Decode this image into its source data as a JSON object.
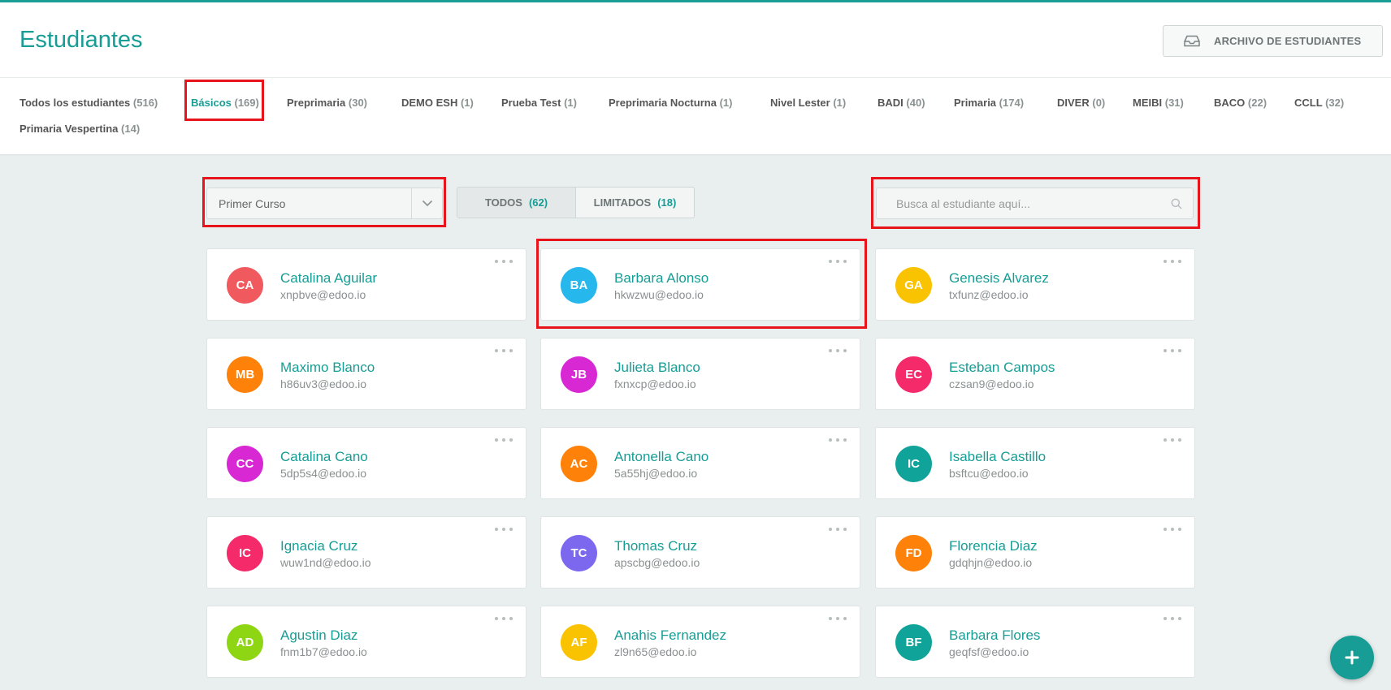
{
  "header": {
    "title": "Estudiantes",
    "archive_button": {
      "label": "ARCHIVO DE ESTUDIANTES",
      "icon": "inbox-icon"
    }
  },
  "levels": [
    {
      "name": "Todos los estudiantes",
      "count": "(516)"
    },
    {
      "name": "Básicos",
      "count": "(169)",
      "active": true
    },
    {
      "name": "Preprimaria",
      "count": "(30)"
    },
    {
      "name": "DEMO ESH",
      "count": "(1)"
    },
    {
      "name": "Prueba Test",
      "count": "(1)"
    },
    {
      "name": "Preprimaria Nocturna",
      "count": "(1)"
    },
    {
      "name": "Nivel Lester",
      "count": "(1)"
    },
    {
      "name": "BADI",
      "count": "(40)"
    },
    {
      "name": "Primaria",
      "count": "(174)"
    },
    {
      "name": "DIVER",
      "count": "(0)"
    },
    {
      "name": "MEIBI",
      "count": "(31)"
    },
    {
      "name": "BACO",
      "count": "(22)"
    },
    {
      "name": "CCLL",
      "count": "(32)"
    },
    {
      "name": "Primaria Vespertina",
      "count": "(14)"
    }
  ],
  "filters": {
    "course_select": {
      "value": "Primer Curso",
      "icon": "chevron-down-icon"
    },
    "segment": [
      {
        "label": "TODOS",
        "count": "(62)",
        "active": true
      },
      {
        "label": "LIMITADOS",
        "count": "(18)"
      }
    ],
    "search": {
      "placeholder": "Busca al estudiante aquí...",
      "value": "",
      "icon": "search-icon"
    }
  },
  "students": [
    {
      "initials": "CA",
      "name": "Catalina Aguilar",
      "email": "xnpbve@edoo.io",
      "color": "#f0595e"
    },
    {
      "initials": "BA",
      "name": "Barbara Alonso",
      "email": "hkwzwu@edoo.io",
      "color": "#26b7ec"
    },
    {
      "initials": "GA",
      "name": "Genesis Alvarez",
      "email": "txfunz@edoo.io",
      "color": "#f9c301"
    },
    {
      "initials": "MB",
      "name": "Maximo Blanco",
      "email": "h86uv3@edoo.io",
      "color": "#fe8109"
    },
    {
      "initials": "JB",
      "name": "Julieta Blanco",
      "email": "fxnxcp@edoo.io",
      "color": "#d728d4"
    },
    {
      "initials": "EC",
      "name": "Esteban Campos",
      "email": "czsan9@edoo.io",
      "color": "#f42a6a"
    },
    {
      "initials": "CC",
      "name": "Catalina Cano",
      "email": "5dp5s4@edoo.io",
      "color": "#d728d4"
    },
    {
      "initials": "AC",
      "name": "Antonella Cano",
      "email": "5a55hj@edoo.io",
      "color": "#fe8109"
    },
    {
      "initials": "IC",
      "name": "Isabella Castillo",
      "email": "bsftcu@edoo.io",
      "color": "#0fa39a"
    },
    {
      "initials": "IC",
      "name": "Ignacia Cruz",
      "email": "wuw1nd@edoo.io",
      "color": "#f42a6a"
    },
    {
      "initials": "TC",
      "name": "Thomas Cruz",
      "email": "apscbg@edoo.io",
      "color": "#7b68ee"
    },
    {
      "initials": "FD",
      "name": "Florencia Diaz",
      "email": "gdqhjn@edoo.io",
      "color": "#fe8109"
    },
    {
      "initials": "AD",
      "name": "Agustin Diaz",
      "email": "fnm1b7@edoo.io",
      "color": "#8ed513"
    },
    {
      "initials": "AF",
      "name": "Anahis Fernandez",
      "email": "zl9n65@edoo.io",
      "color": "#f9c301"
    },
    {
      "initials": "BF",
      "name": "Barbara Flores",
      "email": "geqfsf@edoo.io",
      "color": "#0fa39a"
    }
  ],
  "fab": {
    "icon": "plus-icon"
  },
  "colors": {
    "accent": "#179d95",
    "highlight": "#e8141b"
  }
}
